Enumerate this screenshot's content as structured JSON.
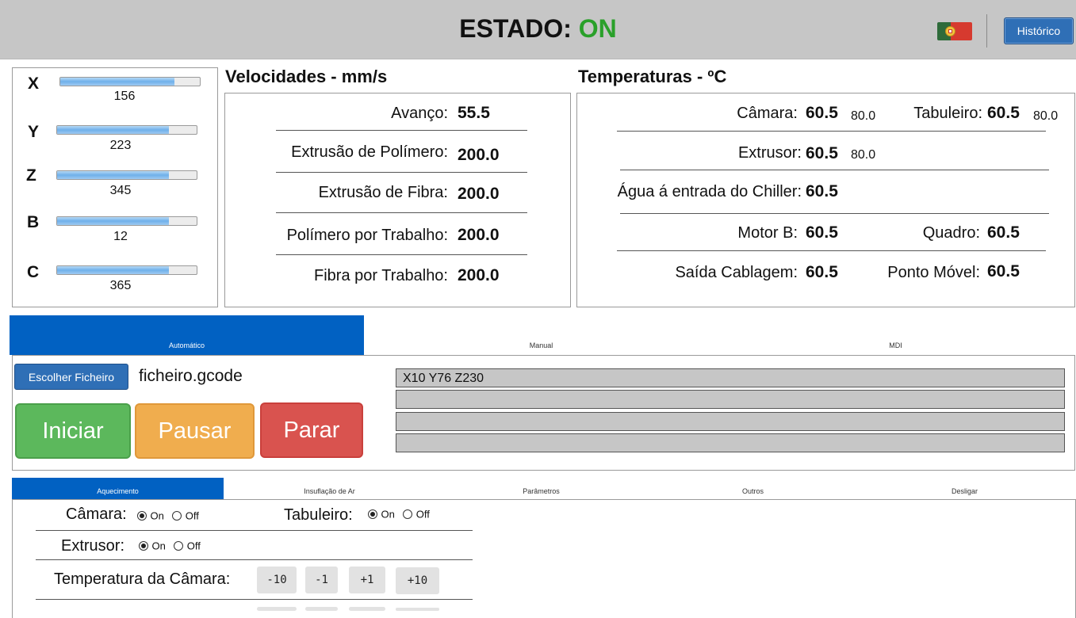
{
  "header": {
    "status_label": "ESTADO:",
    "status_value": "ON",
    "history_button": "Histórico",
    "flag_icon": "portugal-flag-icon"
  },
  "axes": [
    {
      "label": "X",
      "value": "156",
      "fill": 0.82
    },
    {
      "label": "Y",
      "value": "223",
      "fill": 0.8
    },
    {
      "label": "Z",
      "value": "345",
      "fill": 0.8
    },
    {
      "label": "B",
      "value": "12",
      "fill": 0.8
    },
    {
      "label": "C",
      "value": "365",
      "fill": 0.8
    }
  ],
  "speeds": {
    "title": "Velocidades - mm/s",
    "rows": [
      {
        "label": "Avanço:",
        "value": "55.5"
      },
      {
        "label": "Extrusão de Polímero:",
        "value": "200.0"
      },
      {
        "label": "Extrusão de Fibra:",
        "value": "200.0"
      },
      {
        "label": "Polímero por Trabalho:",
        "value": "200.0"
      },
      {
        "label": "Fibra por Trabalho:",
        "value": "200.0"
      }
    ]
  },
  "temperatures": {
    "title": "Temperaturas - ºC",
    "camara": {
      "label": "Câmara:",
      "value": "60.5",
      "target": "80.0"
    },
    "tabuleiro": {
      "label": "Tabuleiro:",
      "value": "60.5",
      "target": "80.0"
    },
    "extrusor": {
      "label": "Extrusor:",
      "value": "60.5",
      "target": "80.0"
    },
    "agua": {
      "label": "Água á entrada do Chiller:",
      "value": "60.5"
    },
    "motor_b": {
      "label": "Motor B:",
      "value": "60.5"
    },
    "quadro": {
      "label": "Quadro:",
      "value": "60.5"
    },
    "saida": {
      "label": "Saída Cablagem:",
      "value": "60.5"
    },
    "ponto": {
      "label": "Ponto Móvel:",
      "value": "60.5"
    }
  },
  "mode_tabs": [
    "Automático",
    "Manual",
    "MDI"
  ],
  "automatic": {
    "choose_file_button": "Escolher Ficheiro",
    "file_name": "ficheiro.gcode",
    "start_button": "Iniciar",
    "pause_button": "Pausar",
    "stop_button": "Parar",
    "gcode_lines": [
      "X10 Y76 Z230",
      "",
      "",
      ""
    ]
  },
  "control_tabs": [
    "Aquecimento",
    "Insuflação de Ar",
    "Parâmetros",
    "Outros",
    "Desligar"
  ],
  "heating": {
    "camara_label": "Câmara:",
    "tabuleiro_label": "Tabuleiro:",
    "extrusor_label": "Extrusor:",
    "on_label": "On",
    "off_label": "Off",
    "camara_temp_label": "Temperatura da Câmara:",
    "steps": [
      "-10",
      "-1",
      "+1",
      "+10"
    ]
  }
}
